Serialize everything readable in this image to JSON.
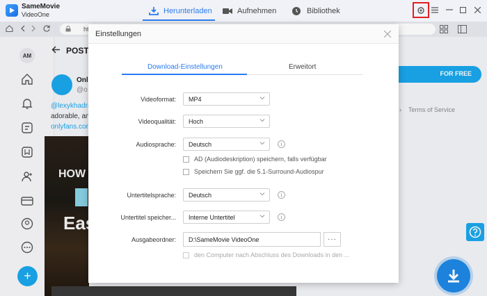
{
  "app": {
    "name": "SameMovie",
    "sub": "VideoOne"
  },
  "main_tabs": [
    {
      "label": "Herunterladen",
      "icon": "download-icon",
      "active": true
    },
    {
      "label": "Aufnehmen",
      "icon": "camera-icon",
      "active": false
    },
    {
      "label": "Bibliothek",
      "icon": "clock-icon",
      "active": false
    }
  ],
  "browser": {
    "url": "https"
  },
  "background": {
    "avatar": "AM",
    "post_title": "POST",
    "profile_name": "Only",
    "profile_handle": "@o",
    "mention": "@lexykhadra",
    "text": "adorable, an",
    "link": "onlyfans.com",
    "video_text_1": "HOW",
    "video_text_2": "Eas",
    "promo": "FOR FREE",
    "tos": "Terms of Service"
  },
  "dialog": {
    "title": "Einstellungen",
    "tabs": [
      {
        "label": "Download-Einstellungen",
        "active": true
      },
      {
        "label": "Erweitort",
        "active": false
      }
    ],
    "video_format": {
      "label": "Videoformat:",
      "value": "MP4"
    },
    "video_quality": {
      "label": "Videoqualität:",
      "value": "Hoch"
    },
    "audio_language": {
      "label": "Audiosprache:",
      "value": "Deutsch"
    },
    "ad_checkbox": "AD (Audiodeskription) speichern, falls verfügbar",
    "surround_checkbox": "Speichern Sie ggf. die 5.1-Surround-Audiospur",
    "subtitle_language": {
      "label": "Untertitelsprache:",
      "value": "Deutsch"
    },
    "subtitle_save": {
      "label": "Untertitel speicher...",
      "value": "Interne Untertitel"
    },
    "output_folder": {
      "label": "Ausgabeordner:",
      "value": "D:\\SameMovie VideoOne",
      "browse": "···"
    },
    "shutdown_checkbox": "den Computer nach Abschluss des Downloads in den ..."
  },
  "colors": {
    "accent": "#2a7cf0",
    "brand": "#1aa7ec",
    "highlight": "#e02020"
  }
}
